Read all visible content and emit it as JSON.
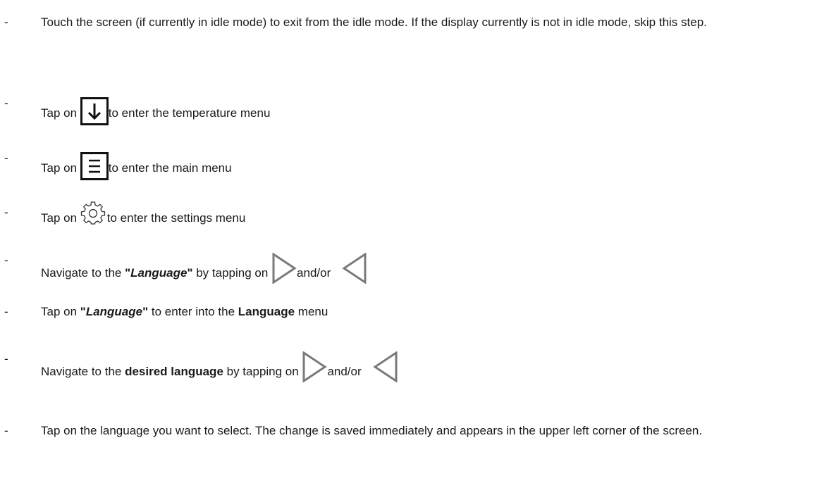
{
  "bullet": "-",
  "steps": [
    {
      "text": "Touch the screen (if currently in idle mode) to exit from the idle mode. If the display currently is not in idle mode, skip this step."
    },
    {
      "prefix": "Tap on ",
      "icon": "arrow-down-box-icon",
      "suffix": "to enter the temperature menu"
    },
    {
      "prefix": "Tap on ",
      "icon": "menu-box-icon",
      "suffix": "to enter the main menu"
    },
    {
      "prefix": "Tap on ",
      "icon": "gear-icon",
      "suffix": "to enter the settings menu"
    },
    {
      "prefix": "Navigate to the ",
      "quote_open": "\"",
      "emphasis": "Language",
      "quote_close": "\"",
      "mid": " by tapping on ",
      "icon1": "triangle-right-icon",
      "and_or": "and/or",
      "icon2": "triangle-left-icon"
    },
    {
      "prefix": "Tap on ",
      "quote_open": "\"",
      "emphasis": "Language",
      "quote_close": "\"",
      "mid": " to enter into the ",
      "bold": "Language",
      "suffix": " menu"
    },
    {
      "prefix": "Navigate to the ",
      "bold": "desired language",
      "mid": " by tapping on ",
      "icon1": "triangle-right-icon",
      "and_or": "and/or",
      "icon2": "triangle-left-icon"
    },
    {
      "text": "Tap on the language you want to select. The change is saved immediately and appears in the upper left corner of the screen."
    }
  ]
}
